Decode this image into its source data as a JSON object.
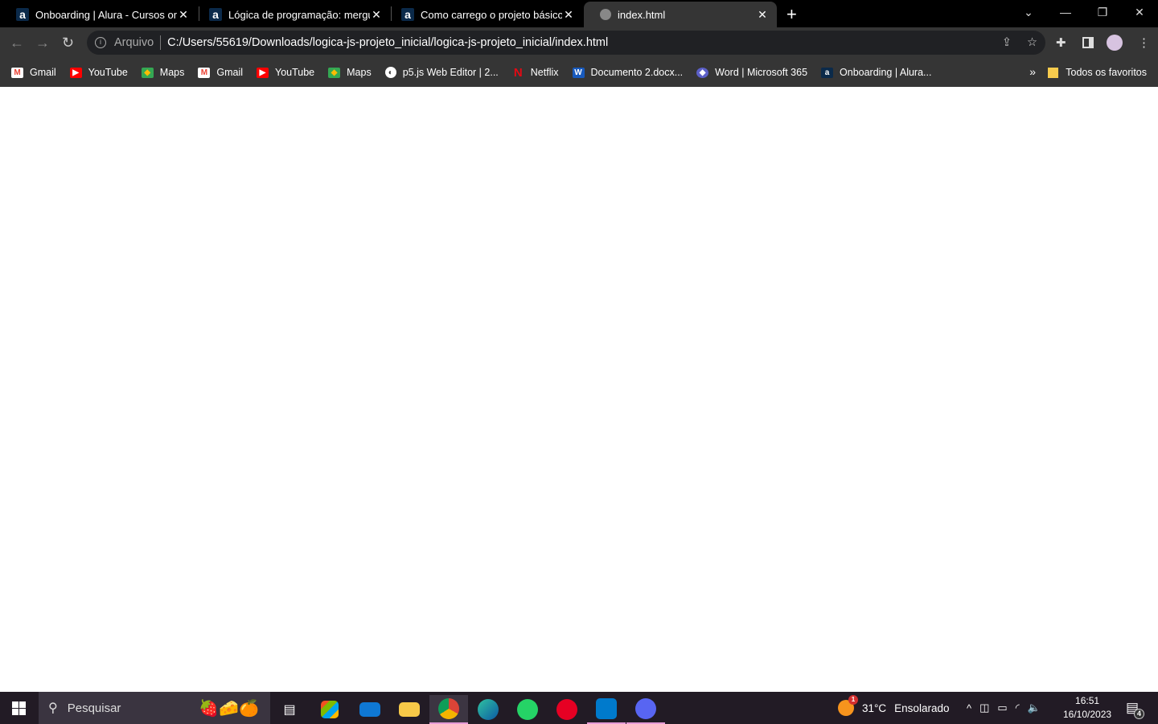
{
  "tabs": [
    {
      "title": "Onboarding | Alura - Cursos online",
      "icon": "alura-icon"
    },
    {
      "title": "Lógica de programação: mergulhe",
      "icon": "alura-icon"
    },
    {
      "title": "Como carrego o projeto básico na",
      "icon": "alura-icon"
    },
    {
      "title": "index.html",
      "icon": "globe-icon",
      "active": true
    }
  ],
  "address": {
    "security_label": "Arquivo",
    "url": "C:/Users/55619/Downloads/logica-js-projeto_inicial/logica-js-projeto_inicial/index.html"
  },
  "bookmarks": [
    {
      "label": "Gmail",
      "icon": "gmail-icon",
      "color": "#ea4335"
    },
    {
      "label": "YouTube",
      "icon": "youtube-icon",
      "color": "#ff0000"
    },
    {
      "label": "Maps",
      "icon": "maps-icon",
      "color": "#34a853"
    },
    {
      "label": "Gmail",
      "icon": "gmail-icon",
      "color": "#ea4335"
    },
    {
      "label": "YouTube",
      "icon": "youtube-icon",
      "color": "#ff0000"
    },
    {
      "label": "Maps",
      "icon": "maps-icon",
      "color": "#34a853"
    },
    {
      "label": "p5.js Web Editor | 2...",
      "icon": "globe-icon",
      "color": "#ffffff"
    },
    {
      "label": "Netflix",
      "icon": "netflix-icon",
      "color": "#e50914"
    },
    {
      "label": "Documento 2.docx...",
      "icon": "word-icon",
      "color": "#185abd"
    },
    {
      "label": "Word | Microsoft 365",
      "icon": "m365-icon",
      "color": "#5b5fc7"
    },
    {
      "label": "Onboarding | Alura...",
      "icon": "alura-icon",
      "color": "#0b2a4a"
    }
  ],
  "all_favorites": "Todos os favoritos",
  "taskbar": {
    "search_placeholder": "Pesquisar",
    "weather": {
      "temp": "31°C",
      "condition": "Ensolarado",
      "badge": "1"
    },
    "time": "16:51",
    "date": "16/10/2023",
    "notifications": "4"
  }
}
